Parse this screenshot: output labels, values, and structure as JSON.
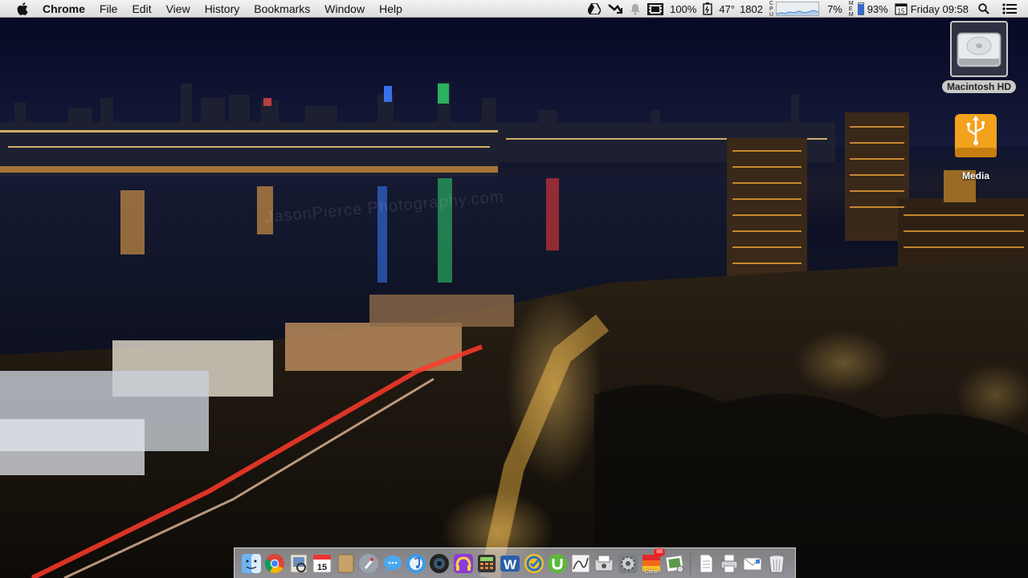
{
  "menubar": {
    "app_name": "Chrome",
    "menus": [
      "File",
      "Edit",
      "View",
      "History",
      "Bookmarks",
      "Window",
      "Help"
    ],
    "status": {
      "volume": "100%",
      "temperature": "47°",
      "fan_speed": "1802",
      "cpu_usage": "7%",
      "memory_usage": "93%",
      "memory_fraction": 0.93,
      "calendar_day": "15",
      "clock": "Friday 09:58"
    },
    "icons": [
      "apple-logo-icon",
      "google-drive-icon",
      "sync-icon",
      "notification-bell-icon",
      "film-icon",
      "battery-icon",
      "spotlight-search-icon",
      "notification-center-icon"
    ]
  },
  "desktop": {
    "icons": [
      {
        "label": "Macintosh HD",
        "icon": "hard-drive-icon"
      },
      {
        "label": "Media",
        "icon": "usb-drive-icon"
      }
    ],
    "watermark": "JasonPierce Photography.com"
  },
  "dock": {
    "badge_count": "88",
    "clear_caption": "Clear",
    "apps": [
      "finder",
      "chrome",
      "preview",
      "calendar",
      "contacts",
      "launchpad",
      "messages",
      "itunes",
      "photo-booth",
      "podcast",
      "calculator",
      "word",
      "wunderlist",
      "utorrent",
      "grapher",
      "scanner",
      "system-preferences",
      "clear",
      "iphoto"
    ],
    "docs": [
      "document",
      "printer",
      "mail-stamp",
      "trash"
    ],
    "calendar_day": "15"
  }
}
